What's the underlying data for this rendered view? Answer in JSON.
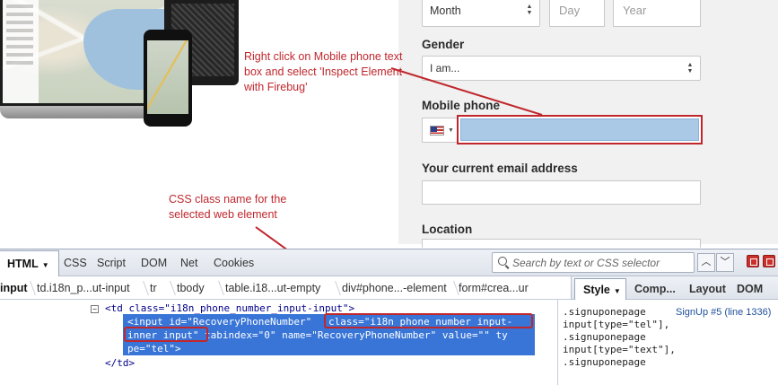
{
  "form": {
    "birth_month": "Month",
    "birth_day_placeholder": "Day",
    "birth_year_placeholder": "Year",
    "gender_label": "Gender",
    "gender_value": "I am...",
    "mobile_label": "Mobile phone",
    "email_label": "Your current email address",
    "location_label": "Location"
  },
  "annotations": {
    "inspect_note": "Right click on Mobile phone text box and select 'Inspect Element with Firebug'",
    "css_note": "CSS class name for the selected web element"
  },
  "firebug": {
    "tabs": [
      "HTML",
      "CSS",
      "Script",
      "DOM",
      "Net",
      "Cookies"
    ],
    "search_placeholder": "Search by text or CSS selector",
    "breadcrumb": [
      "input",
      "td.i18n_p...ut-input",
      "tr",
      "tbody",
      "table.i18...ut-empty",
      "div#phone...-element",
      "form#crea...ur"
    ],
    "side_tabs": [
      "Style",
      "Comp...",
      "Layout",
      "DOM"
    ],
    "tree": {
      "parent_line": "<td class=\"i18n_phone_number_input-input\">",
      "sel_line1_a": "<input id=\"RecoveryPhoneNumber\" ",
      "sel_line1_b": "class=\"i18n_phone_number_input-",
      "sel_line2_a": "inner_input\"",
      "sel_line2_b": " tabindex=\"0\" name=\"RecoveryPhoneNumber\" value=\"\" ty",
      "sel_line3": "pe=\"tel\">",
      "close_line": "</td>"
    },
    "style": {
      "lines": [
        ".signuponepage",
        "input[type=\"tel\"],",
        ".signuponepage",
        "input[type=\"text\"],",
        ".signuponepage"
      ],
      "source_ref": "SignUp #5 (line 1336)"
    }
  },
  "colors": {
    "annotation_red": "#c0272d",
    "selection_blue": "#3875d7",
    "phone_field_fill": "#a9c9e6",
    "form_bg": "#f1f1f1"
  },
  "icons": [
    "laptop-phone-illustration",
    "us-flag-icon",
    "search-icon",
    "prev-arrow-icon",
    "next-arrow-icon",
    "minimize-icon",
    "close-icon",
    "expand-collapse-icon"
  ]
}
